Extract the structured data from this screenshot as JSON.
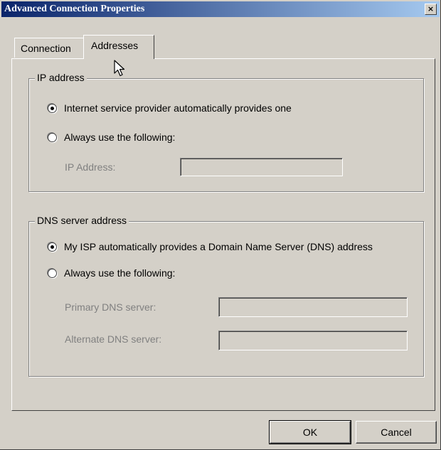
{
  "window": {
    "title": "Advanced Connection Properties",
    "close_label": "×"
  },
  "tabs": {
    "connection": "Connection",
    "addresses": "Addresses",
    "selected": "Addresses"
  },
  "ip_group": {
    "legend": "IP address",
    "option_auto": "Internet service provider automatically provides one",
    "option_manual": "Always use the following:",
    "selected": "auto",
    "ip_label": "IP Address:",
    "ip_value": ""
  },
  "dns_group": {
    "legend": "DNS server address",
    "option_auto": "My ISP automatically provides a Domain Name Server (DNS) address",
    "option_manual": "Always use the following:",
    "selected": "auto",
    "primary_label": "Primary DNS server:",
    "primary_value": "",
    "alternate_label": "Alternate DNS server:",
    "alternate_value": ""
  },
  "buttons": {
    "ok": "OK",
    "cancel": "Cancel"
  },
  "icons": {
    "cursor": "arrow-cursor-icon",
    "close": "close-icon"
  },
  "colors": {
    "face": "#d4d0c8",
    "title_start": "#0a246a",
    "title_end": "#a6caf0",
    "disabled_text": "#808080"
  }
}
